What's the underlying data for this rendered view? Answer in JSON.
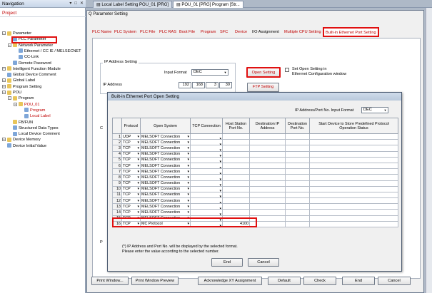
{
  "navigation": {
    "title": "Navigation",
    "project": "Project",
    "tree": [
      {
        "label": "Parameter",
        "indent": 0,
        "exp": "-",
        "icon": "folder"
      },
      {
        "label": "PLC Parameter",
        "indent": 1,
        "exp": "",
        "icon": "doc"
      },
      {
        "label": "Network Parameter",
        "indent": 1,
        "exp": "-",
        "icon": "folder"
      },
      {
        "label": "Ethernet / CC IE / MELSECNET",
        "indent": 2,
        "exp": "",
        "icon": "doc"
      },
      {
        "label": "CC-Link",
        "indent": 2,
        "exp": "",
        "icon": "doc"
      },
      {
        "label": "Remote Password",
        "indent": 1,
        "exp": "",
        "icon": "doc"
      },
      {
        "label": "Intelligent Function Module",
        "indent": 0,
        "exp": "+",
        "icon": "folder"
      },
      {
        "label": "Global Device Comment",
        "indent": 0,
        "exp": "",
        "icon": "doc"
      },
      {
        "label": "Global Label",
        "indent": 0,
        "exp": "+",
        "icon": "folder"
      },
      {
        "label": "Program Setting",
        "indent": 0,
        "exp": "+",
        "icon": "folder"
      },
      {
        "label": "POU",
        "indent": 0,
        "exp": "-",
        "icon": "folder"
      },
      {
        "label": "Program",
        "indent": 1,
        "exp": "-",
        "icon": "folder"
      },
      {
        "label": "POU_01",
        "indent": 2,
        "exp": "-",
        "icon": "folder",
        "red": true
      },
      {
        "label": "Program",
        "indent": 3,
        "exp": "",
        "icon": "doc",
        "red": true
      },
      {
        "label": "Local Label",
        "indent": 3,
        "exp": "",
        "icon": "doc",
        "red": true
      },
      {
        "label": "FB/FUN",
        "indent": 1,
        "exp": "",
        "icon": "folder"
      },
      {
        "label": "Structured Data Types",
        "indent": 1,
        "exp": "",
        "icon": "doc"
      },
      {
        "label": "Local Device Comment",
        "indent": 1,
        "exp": "",
        "icon": "doc"
      },
      {
        "label": "Device Memory",
        "indent": 0,
        "exp": "+",
        "icon": "folder"
      },
      {
        "label": "Device Initial Value",
        "indent": 0,
        "exp": "",
        "icon": "doc"
      }
    ]
  },
  "doc_tabs": [
    {
      "label": "Local Label Setting POU_01 [PRG]"
    },
    {
      "label": "POU_01 [PRG] Program [Str..."
    }
  ],
  "window": {
    "title": "Q Parameter Setting",
    "tabs": [
      "PLC Name",
      "PLC System",
      "PLC File",
      "PLC RAS",
      "Boot File",
      "Program",
      "SFC",
      "Device",
      "I/O Assignment",
      "Multiple CPU Setting",
      "Built-in Ethernet Port Setting"
    ],
    "ip_group_label": "IP Address Setting",
    "input_format_label": "Input Format",
    "input_format_value": "DEC",
    "ip_label": "IP Address",
    "ip": [
      "192",
      "168",
      "3",
      "39"
    ],
    "open_setting": "Open Setting",
    "open_setting_desc_1": "Set Open Setting in",
    "open_setting_desc_2": "Ethernet Configuration window",
    "ftp_setting": "FTP Setting",
    "side_c": "C",
    "side_p": "P",
    "buttons": [
      "Print Window...",
      "Print Window Preview",
      "Acknowledge XY Assignment",
      "Default",
      "Check",
      "End",
      "Cancel"
    ]
  },
  "dialog": {
    "title": "Built-in Ethernet Port Open Setting",
    "format_label": "IP Address/Port No. Input Format",
    "format_value": "DEC",
    "headers": [
      "",
      "Protocol",
      "Open System",
      "TCP Connection",
      "Host Station Port No.",
      "Destination IP Address",
      "Destination Port No.",
      "Start Device to Store Predefined Protocol Operation Status"
    ],
    "rows": [
      {
        "no": "1",
        "protocol": "UDP",
        "open": "MELSOFT Connection",
        "port": ""
      },
      {
        "no": "2",
        "protocol": "TCP",
        "open": "MELSOFT Connection",
        "port": ""
      },
      {
        "no": "3",
        "protocol": "TCP",
        "open": "MELSOFT Connection",
        "port": ""
      },
      {
        "no": "4",
        "protocol": "TCP",
        "open": "MELSOFT Connection",
        "port": ""
      },
      {
        "no": "5",
        "protocol": "TCP",
        "open": "MELSOFT Connection",
        "port": ""
      },
      {
        "no": "6",
        "protocol": "TCP",
        "open": "MELSOFT Connection",
        "port": ""
      },
      {
        "no": "7",
        "protocol": "TCP",
        "open": "MELSOFT Connection",
        "port": ""
      },
      {
        "no": "8",
        "protocol": "TCP",
        "open": "MELSOFT Connection",
        "port": ""
      },
      {
        "no": "9",
        "protocol": "TCP",
        "open": "MELSOFT Connection",
        "port": ""
      },
      {
        "no": "10",
        "protocol": "TCP",
        "open": "MELSOFT Connection",
        "port": ""
      },
      {
        "no": "11",
        "protocol": "TCP",
        "open": "MELSOFT Connection",
        "port": ""
      },
      {
        "no": "12",
        "protocol": "TCP",
        "open": "MELSOFT Connection",
        "port": ""
      },
      {
        "no": "13",
        "protocol": "TCP",
        "open": "MELSOFT Connection",
        "port": ""
      },
      {
        "no": "14",
        "protocol": "TCP",
        "open": "MELSOFT Connection",
        "port": ""
      },
      {
        "no": "15",
        "protocol": "TCP",
        "open": "MELSOFT Connection",
        "port": ""
      },
      {
        "no": "16",
        "protocol": "TCP",
        "open": "MC Protocol",
        "port": "4100"
      }
    ],
    "note_1": "(*) IP Address and Port No. will be displayed by the selected format.",
    "note_2": "Please enter the value according to the selected number.",
    "end": "End",
    "cancel": "Cancel"
  },
  "colors": {
    "highlight": "#e01010",
    "red_text": "#c00000"
  }
}
